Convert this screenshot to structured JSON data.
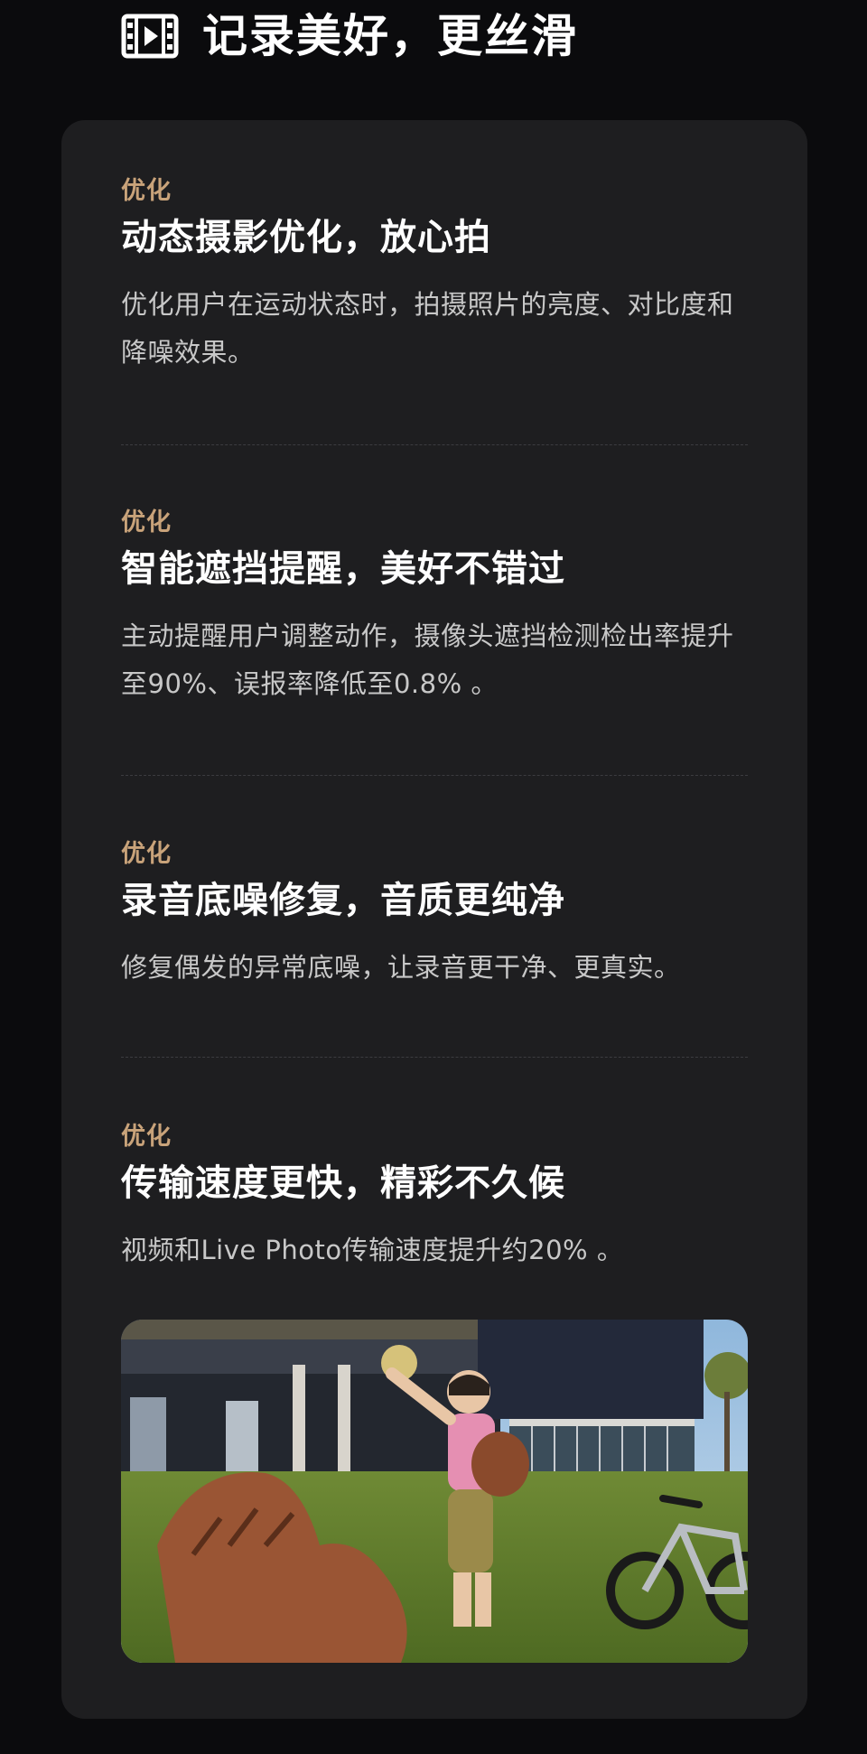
{
  "header": {
    "icon": "film-strip-icon",
    "title": "记录美好，更丝滑"
  },
  "sections": [
    {
      "tag": "优化",
      "heading": "动态摄影优化，放心拍",
      "description": "优化用户在运动状态时，拍摄照片的亮度、对比度和降噪效果。"
    },
    {
      "tag": "优化",
      "heading": "智能遮挡提醒，美好不错过",
      "description": "主动提醒用户调整动作，摄像头遮挡检测检出率提升至90%、误报率降低至0.8% 。"
    },
    {
      "tag": "优化",
      "heading": "录音底噪修复，音质更纯净",
      "description": "修复偶发的异常底噪，让录音更干净、更真实。"
    },
    {
      "tag": "优化",
      "heading": "传输速度更快，精彩不久候",
      "description": "视频和Live Photo传输速度提升约20% 。"
    }
  ],
  "colors": {
    "background": "#0b0b0d",
    "card": "#1e1e20",
    "accent_tag": "#c9a37a",
    "heading": "#ffffff",
    "body_text": "#c8c8c8"
  }
}
